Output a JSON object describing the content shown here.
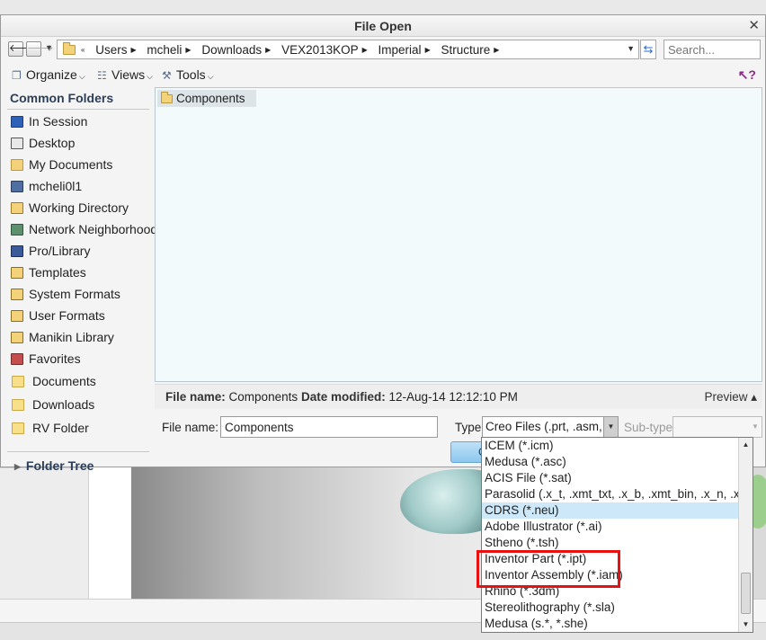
{
  "dialog": {
    "title": "File Open"
  },
  "address": {
    "crumbs": [
      "Users",
      "mcheli",
      "Downloads",
      "VEX2013KOP",
      "Imperial",
      "Structure"
    ]
  },
  "search": {
    "placeholder": "Search..."
  },
  "toolbar": {
    "organize": "Organize",
    "views": "Views",
    "tools": "Tools"
  },
  "sidebar": {
    "header": "Common Folders",
    "items": [
      {
        "label": "In Session",
        "icon": "session-icon"
      },
      {
        "label": "Desktop",
        "icon": "desktop-icon"
      },
      {
        "label": "My Documents",
        "icon": "documents-icon"
      },
      {
        "label": "mcheli0l1",
        "icon": "computer-icon"
      },
      {
        "label": "Working Directory",
        "icon": "working-directory-icon"
      },
      {
        "label": "Network Neighborhood",
        "icon": "network-icon"
      },
      {
        "label": "Pro/Library",
        "icon": "library-icon"
      },
      {
        "label": "Templates",
        "icon": "templates-icon"
      },
      {
        "label": "System Formats",
        "icon": "system-formats-icon"
      },
      {
        "label": "User Formats",
        "icon": "user-formats-icon"
      },
      {
        "label": "Manikin Library",
        "icon": "manikin-icon"
      },
      {
        "label": "Favorites",
        "icon": "favorites-icon"
      }
    ],
    "favorites": [
      {
        "label": "Documents"
      },
      {
        "label": "Downloads"
      },
      {
        "label": "RV Folder"
      }
    ],
    "folder_tree": "Folder Tree"
  },
  "file_list": [
    {
      "name": "Components",
      "icon": "folder-icon"
    }
  ],
  "details": {
    "file_name_label": "File name:",
    "file_name_value": "Components",
    "date_modified_label": "Date modified:",
    "date_modified_value": "12-Aug-14 12:12:10 PM",
    "preview": "Preview"
  },
  "form": {
    "file_name_label": "File name:",
    "file_name_value": "Components",
    "type_label": "Type",
    "type_value": "Creo Files (.prt, .asm,",
    "subtype_label": "Sub-type",
    "open_button_partial": "O"
  },
  "type_dropdown": {
    "options": [
      {
        "label": "ICEM (*.icm)"
      },
      {
        "label": "Medusa (*.asc)"
      },
      {
        "label": "ACIS File (*.sat)"
      },
      {
        "label": "Parasolid (.x_t, .xmt_txt, .x_b, .xmt_bin, .x_n, .x"
      },
      {
        "label": "CDRS (*.neu)",
        "selected": true
      },
      {
        "label": "Adobe Illustrator (*.ai)"
      },
      {
        "label": "Stheno (*.tsh)"
      },
      {
        "label": "Inventor Part (*.ipt)",
        "highlighted": true
      },
      {
        "label": "Inventor Assembly (*.iam)",
        "highlighted": true
      },
      {
        "label": "Rhino (*.3dm)"
      },
      {
        "label": "Stereolithography (*.sla)"
      },
      {
        "label": "Medusa (s.*, *.she)"
      }
    ]
  },
  "colors": {
    "highlight_border": "#e81010",
    "selected_row": "#cde8f8",
    "file_area_bg": "#f3fafc"
  }
}
